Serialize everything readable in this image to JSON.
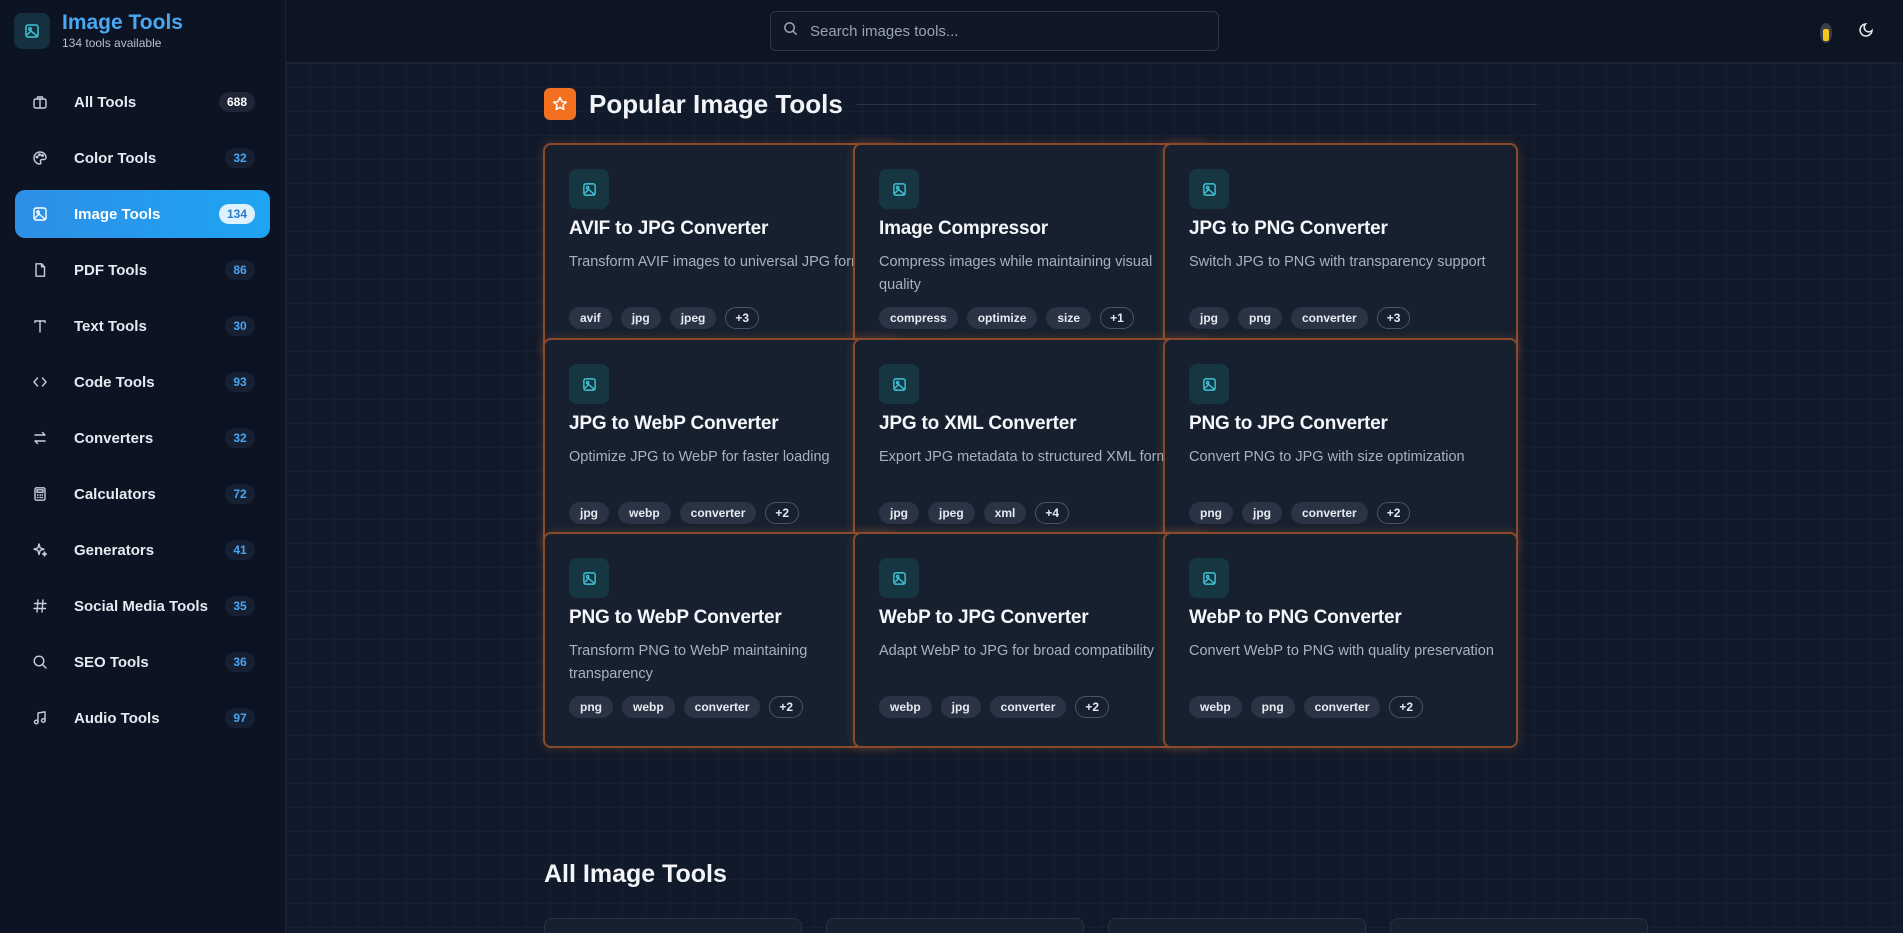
{
  "brand": {
    "title": "Image Tools",
    "subtitle": "134 tools available"
  },
  "search": {
    "placeholder": "Search images tools..."
  },
  "sidebar": {
    "items": [
      {
        "label": "All Tools",
        "count": "688",
        "icon": "grid-icon"
      },
      {
        "label": "Color Tools",
        "count": "32",
        "icon": "palette-icon"
      },
      {
        "label": "Image Tools",
        "count": "134",
        "icon": "image-icon",
        "active": true
      },
      {
        "label": "PDF Tools",
        "count": "86",
        "icon": "file-icon"
      },
      {
        "label": "Text Tools",
        "count": "30",
        "icon": "text-icon"
      },
      {
        "label": "Code Tools",
        "count": "93",
        "icon": "code-icon"
      },
      {
        "label": "Converters",
        "count": "32",
        "icon": "arrows-icon"
      },
      {
        "label": "Calculators",
        "count": "72",
        "icon": "calculator-icon"
      },
      {
        "label": "Generators",
        "count": "41",
        "icon": "sparkles-icon"
      },
      {
        "label": "Social Media Tools",
        "count": "35",
        "icon": "hash-icon"
      },
      {
        "label": "SEO Tools",
        "count": "36",
        "icon": "search-icon"
      },
      {
        "label": "Audio Tools",
        "count": "97",
        "icon": "music-icon"
      }
    ]
  },
  "popular": {
    "title": "Popular Image Tools",
    "cards": [
      {
        "title": "AVIF to JPG Converter",
        "desc": "Transform AVIF images to universal JPG format",
        "tags": [
          "avif",
          "jpg",
          "jpeg"
        ],
        "more": "+3"
      },
      {
        "title": "Image Compressor",
        "desc": "Compress images while maintaining visual quality",
        "tags": [
          "compress",
          "optimize",
          "size"
        ],
        "more": "+1"
      },
      {
        "title": "JPG to PNG Converter",
        "desc": "Switch JPG to PNG with transparency support",
        "tags": [
          "jpg",
          "png",
          "converter"
        ],
        "more": "+3"
      },
      {
        "title": "JPG to WebP Converter",
        "desc": "Optimize JPG to WebP for faster loading",
        "tags": [
          "jpg",
          "webp",
          "converter"
        ],
        "more": "+2"
      },
      {
        "title": "JPG to XML Converter",
        "desc": "Export JPG metadata to structured XML format",
        "tags": [
          "jpg",
          "jpeg",
          "xml"
        ],
        "more": "+4"
      },
      {
        "title": "PNG to JPG Converter",
        "desc": "Convert PNG to JPG with size optimization",
        "tags": [
          "png",
          "jpg",
          "converter"
        ],
        "more": "+2"
      },
      {
        "title": "PNG to WebP Converter",
        "desc": "Transform PNG to WebP maintaining transparency",
        "tags": [
          "png",
          "webp",
          "converter"
        ],
        "more": "+2"
      },
      {
        "title": "WebP to JPG Converter",
        "desc": "Adapt WebP to JPG for broad compatibility",
        "tags": [
          "webp",
          "jpg",
          "converter"
        ],
        "more": "+2"
      },
      {
        "title": "WebP to PNG Converter",
        "desc": "Convert WebP to PNG with quality preservation",
        "tags": [
          "webp",
          "png",
          "converter"
        ],
        "more": "+2"
      }
    ]
  },
  "all": {
    "title": "All Image Tools"
  },
  "colors": {
    "accent": "#2d8fe6",
    "card_border": "#8a4a2a",
    "star": "#f2701f"
  }
}
